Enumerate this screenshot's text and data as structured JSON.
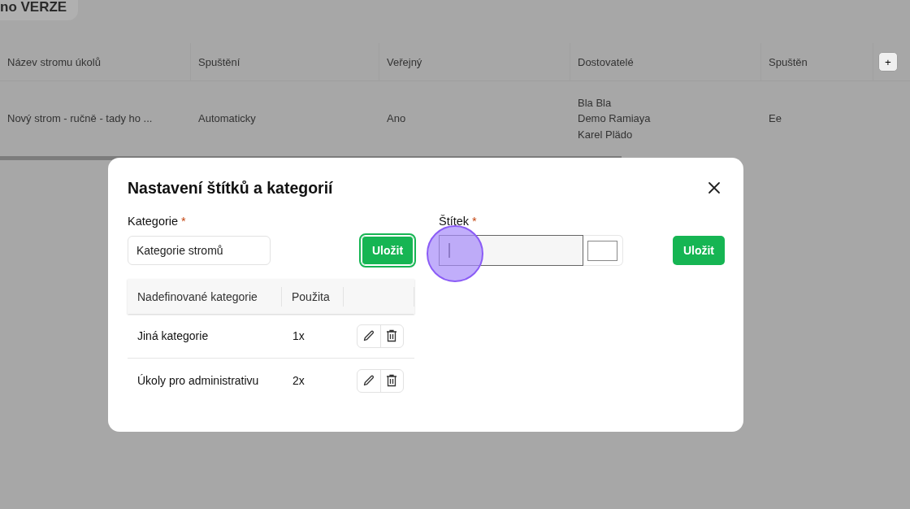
{
  "backdrop": {
    "badge": "no VERZE",
    "columns": [
      "Název stromu úkolů",
      "Spuštění",
      "Veřejný",
      "Dostovatelé",
      "Spuštěn"
    ],
    "add_column": "+",
    "rows": [
      {
        "cells": [
          [
            "Nový strom - ručně - tady ho ..."
          ],
          [
            "Automaticky"
          ],
          [
            "Ano"
          ],
          [
            "Bla Bla",
            "Demo Ramiaya",
            "Karel Plädo"
          ],
          [
            "Ee"
          ]
        ]
      }
    ]
  },
  "dialog": {
    "title": "Nastavení štítků a kategorií",
    "category": {
      "label": "Kategorie",
      "required_mark": "*",
      "value": "Kategorie stromů",
      "save": {
        "label": "Uložit",
        "focused": true
      },
      "table": {
        "columns": [
          "Nadefinované kategorie",
          "Použita"
        ],
        "rows": [
          {
            "name": "Jiná kategorie",
            "used": "1x"
          },
          {
            "name": "Úkoly pro administrativu",
            "used": "2x"
          }
        ]
      }
    },
    "tag": {
      "label": "Štítek",
      "required_mark": "*",
      "focused": true,
      "save": {
        "label": "Uložit",
        "focused": false
      }
    }
  },
  "click_indicator": true
}
